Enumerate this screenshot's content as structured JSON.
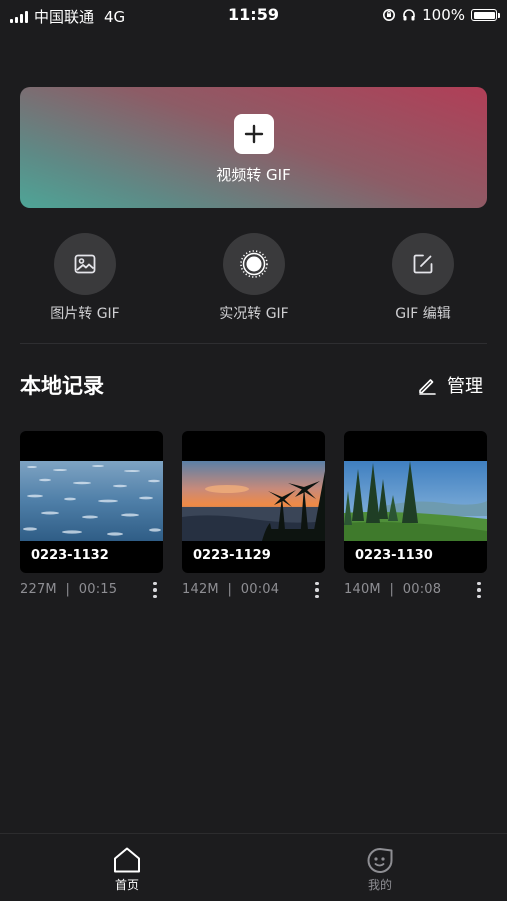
{
  "status_bar": {
    "carrier": "中国联通",
    "network": "4G",
    "time": "11:59",
    "battery": "100%"
  },
  "hero": {
    "label": "视频转 GIF",
    "colors": {
      "from": "#b13e57",
      "to": "#4ea597"
    }
  },
  "tools": [
    {
      "label": "图片转 GIF",
      "icon": "image-icon"
    },
    {
      "label": "实况转 GIF",
      "icon": "live-photo-icon"
    },
    {
      "label": "GIF 编辑",
      "icon": "edit-icon"
    }
  ],
  "section": {
    "title": "本地记录",
    "manage_label": "管理"
  },
  "records": [
    {
      "name": "0223-1132",
      "size": "227M",
      "duration": "00:15",
      "thumbnail": "ocean-waves"
    },
    {
      "name": "0223-1129",
      "size": "142M",
      "duration": "00:04",
      "thumbnail": "sunset-palm-beach"
    },
    {
      "name": "0223-1130",
      "size": "140M",
      "duration": "00:08",
      "thumbnail": "pine-trees-meadow"
    }
  ],
  "tabbar": {
    "home_label": "首页",
    "mine_label": "我的",
    "active": "home"
  },
  "colors": {
    "background": "#1c1c1e",
    "tool_circle": "#3a3a3c",
    "muted_text": "#8e8e93"
  }
}
